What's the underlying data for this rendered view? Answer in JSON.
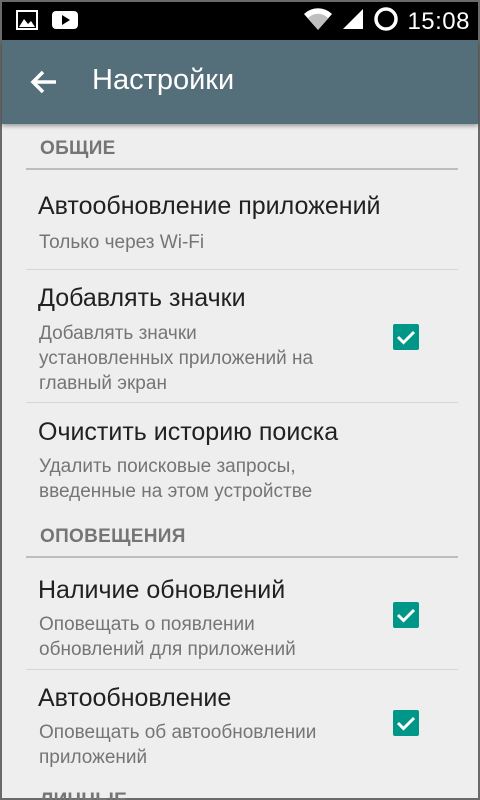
{
  "status_bar": {
    "icons": [
      "image-icon",
      "youtube-icon",
      "wifi-icon",
      "signal-icon",
      "sync-icon"
    ],
    "time": "15:08"
  },
  "app_bar": {
    "title": "Настройки",
    "back_icon": "arrow-left-icon"
  },
  "sections": {
    "general": {
      "header": "ОБЩИЕ",
      "auto_update": {
        "title": "Автообновление приложений",
        "summary": "Только через Wi-Fi"
      },
      "add_icons": {
        "title": "Добавлять значки",
        "summary_lines": [
          "Добавлять значки",
          "установленных приложений на",
          "главный экран"
        ],
        "checked": true
      },
      "clear_history": {
        "title": "Очистить историю поиска",
        "summary_lines": [
          "Удалить поисковые запросы,",
          "введенные на этом устройстве"
        ]
      }
    },
    "notifications": {
      "header": "ОПОВЕЩЕНИЯ",
      "updates_available": {
        "title": "Наличие обновлений",
        "summary_lines": [
          "Оповещать о появлении",
          "обновлений для приложений"
        ],
        "checked": true
      },
      "auto_update_notify": {
        "title": "Автообновление",
        "summary_lines": [
          "Оповещать об автообновлении",
          "приложений"
        ],
        "checked": true
      }
    },
    "personal": {
      "header": "ЛИЧНЫЕ"
    }
  },
  "colors": {
    "app_bar": "#546e7a",
    "accent": "#009688",
    "background": "#eeeeee"
  }
}
